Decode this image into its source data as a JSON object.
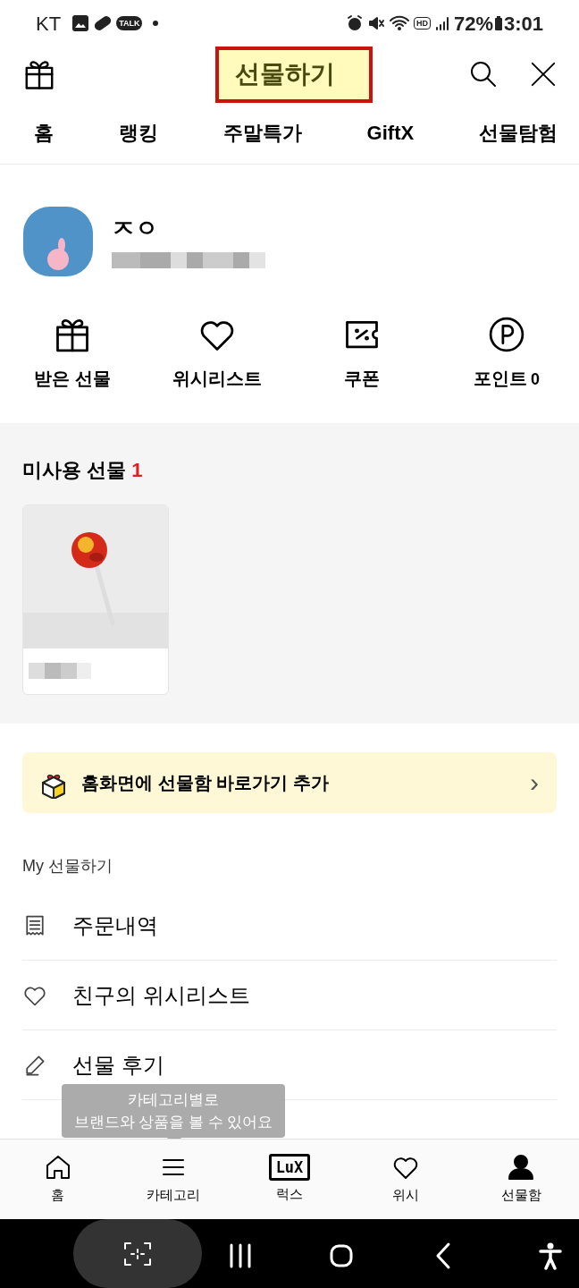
{
  "status_bar": {
    "carrier": "KT",
    "talk_badge": "TALK",
    "hd_badge": "HD",
    "battery": "72%",
    "time": "3:01"
  },
  "header": {
    "title": "선물하기"
  },
  "tabs": [
    {
      "label": "홈"
    },
    {
      "label": "랭킹"
    },
    {
      "label": "주말특가"
    },
    {
      "label": "GiftX"
    },
    {
      "label": "선물탐험"
    }
  ],
  "profile": {
    "name": "ㅈㅇ"
  },
  "quick_actions": [
    {
      "kind": "gift",
      "label": "받은 선물"
    },
    {
      "kind": "heart",
      "label": "위시리스트"
    },
    {
      "kind": "coupon",
      "label": "쿠폰"
    },
    {
      "kind": "point",
      "label": "포인트",
      "count": "0"
    }
  ],
  "unused_gifts": {
    "title": "미사용 선물",
    "count": "1"
  },
  "banner": {
    "text": "홈화면에 선물함 바로가기 추가",
    "chevron": "›"
  },
  "my_section": {
    "title": "My 선물하기",
    "items": [
      {
        "kind": "receipt",
        "label": "주문내역"
      },
      {
        "kind": "heart",
        "label": "친구의 위시리스트"
      },
      {
        "kind": "pencil",
        "label": "선물 후기"
      }
    ]
  },
  "tooltip": {
    "lines": [
      "카테고리별로",
      "브랜드와 상품을 볼 수 있어요"
    ]
  },
  "bottom_nav": [
    {
      "kind": "home",
      "label": "홈"
    },
    {
      "kind": "menu",
      "label": "카테고리"
    },
    {
      "kind": "lux",
      "badge": "LuX",
      "label": "럭스"
    },
    {
      "kind": "heart",
      "label": "위시"
    },
    {
      "kind": "person",
      "label": "선물함"
    }
  ]
}
